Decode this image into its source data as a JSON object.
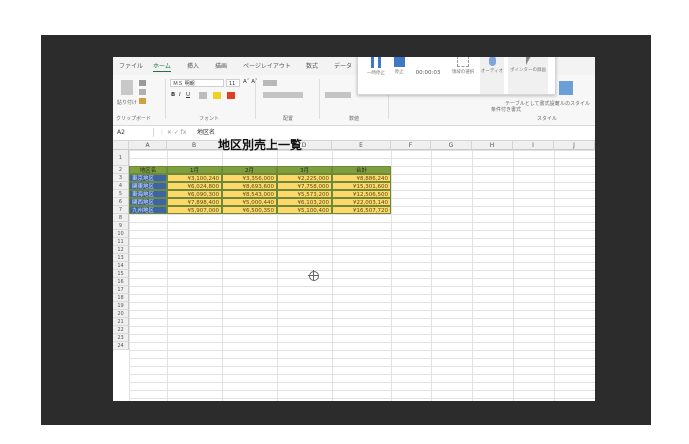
{
  "ribbon_tabs": [
    "ファイル",
    "ホーム",
    "挿入",
    "描画",
    "ページレイアウト",
    "数式",
    "データ"
  ],
  "ribbon": {
    "clipboard_label": "クリップボード",
    "paste_label": "貼り付け",
    "font_name": "ＭＳ 明朝",
    "font_size": "11",
    "font_group_label": "フォント",
    "align_group_label": "配置",
    "number_group_label": "数値",
    "style_group_label": "スタイル",
    "cond_format_label": "条件付き書式",
    "table_format_label": "テーブルとして書式設定",
    "cell_style_label": "セルのスタイル"
  },
  "recording_toolbar": {
    "pause_label": "一時停止",
    "stop_label": "停止",
    "timer": "00:00:03",
    "area_label": "領域の選択",
    "audio_label": "オーディオ",
    "pointer_label": "ポインターの録画"
  },
  "formula_bar": {
    "name_box": "A2",
    "formula": "地区名"
  },
  "columns": [
    "A",
    "B",
    "C",
    "D",
    "E",
    "F",
    "G",
    "H",
    "I",
    "J"
  ],
  "rows": [
    "1",
    "2",
    "3",
    "4",
    "5",
    "6",
    "7",
    "8",
    "9",
    "10",
    "11",
    "12",
    "13",
    "14",
    "15",
    "16",
    "17",
    "18",
    "19",
    "20",
    "21",
    "22",
    "23",
    "24"
  ],
  "sheet_title": "地区別売上一覧",
  "table": {
    "headers": [
      "地区名",
      "1月",
      "2月",
      "3月",
      "合計"
    ],
    "rows": [
      [
        "東京地区",
        "¥3,100,240",
        "¥3,356,000",
        "¥2,225,000",
        "¥8,886,240"
      ],
      [
        "関東地区",
        "¥6,024,800",
        "¥8,693,600",
        "¥7,758,000",
        "¥15,301,600"
      ],
      [
        "東海地区",
        "¥6,090,300",
        "¥8,543,000",
        "¥5,573,200",
        "¥12,506,500"
      ],
      [
        "関西地区",
        "¥7,898,400",
        "¥5,000,440",
        "¥6,103,200",
        "¥22,003,140"
      ],
      [
        "九州地区",
        "¥5,907,000",
        "¥6,500,350",
        "¥5,100,400",
        "¥16,507,720"
      ]
    ]
  },
  "colors": {
    "frame_bg": "#2c2c2c",
    "header_fill": "#7f9f3f",
    "name_fill": "#3f64a6",
    "value_fill": "#ffd86b",
    "ribbon_accent": "#217346"
  }
}
